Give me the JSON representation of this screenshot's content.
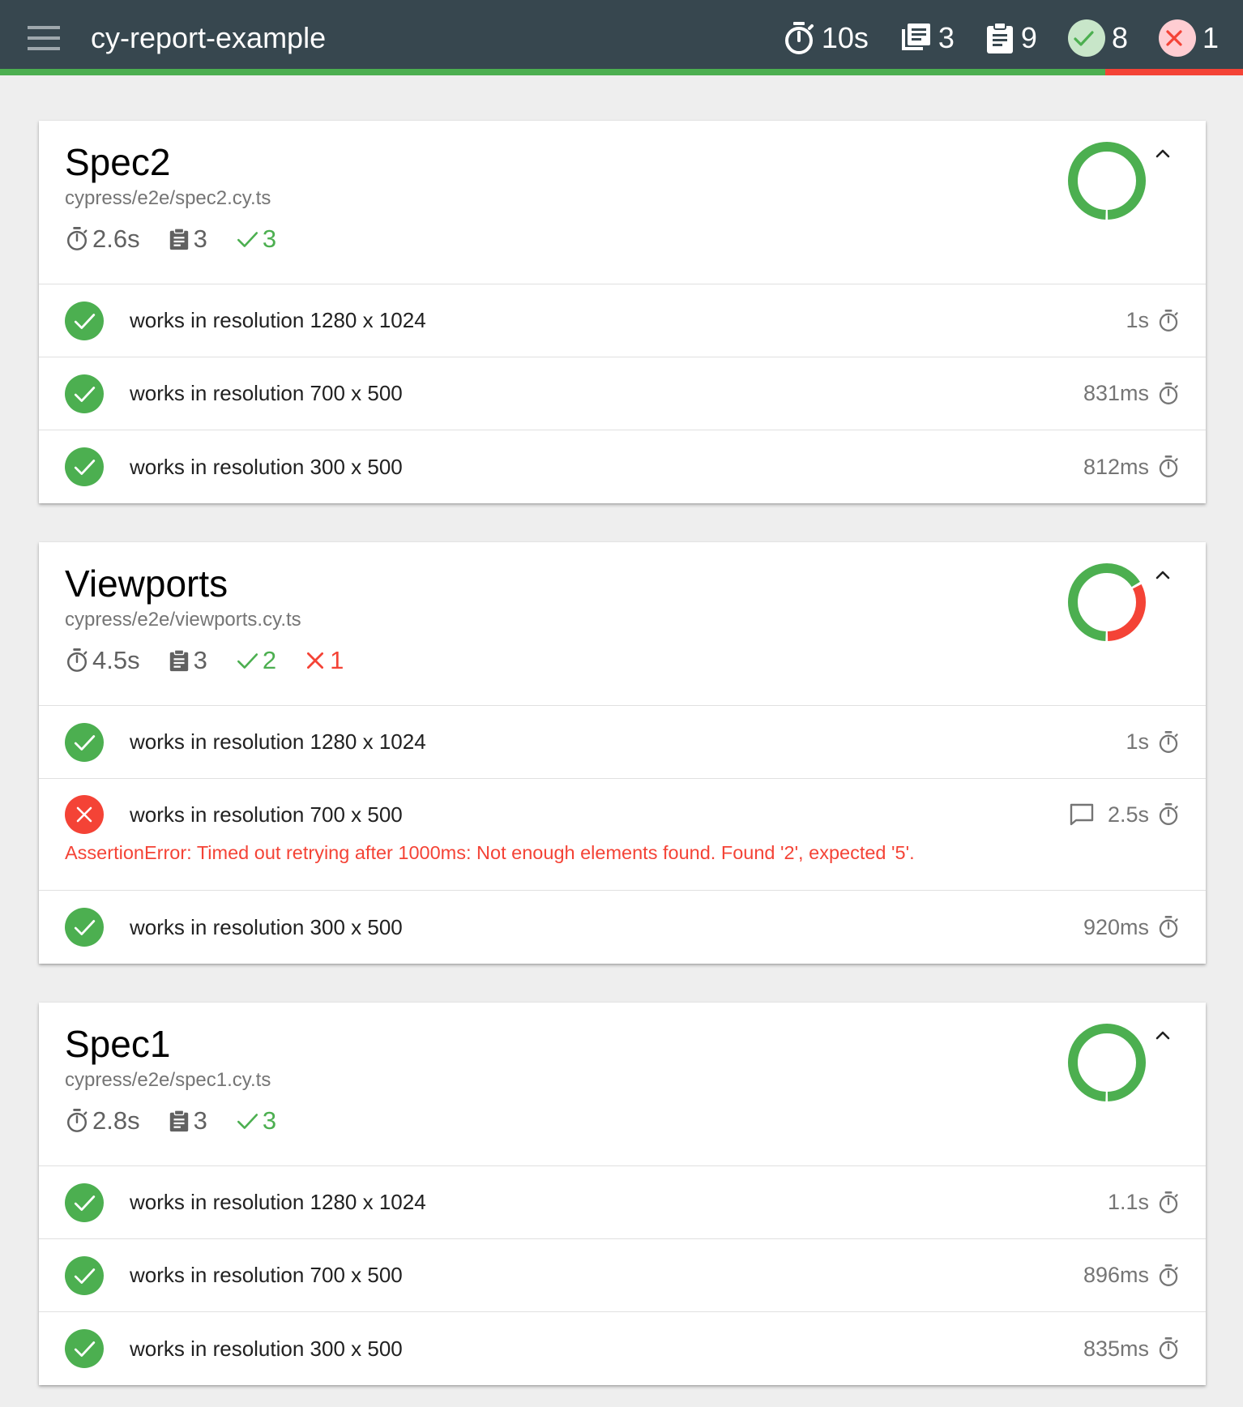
{
  "header": {
    "title": "cy-report-example",
    "stats": {
      "duration": "10s",
      "suites": "3",
      "tests": "9",
      "passed": "8",
      "failed": "1"
    },
    "pass_fraction": 0.889
  },
  "colors": {
    "topbar": "#37474f",
    "pass": "#4caf50",
    "fail": "#f44336",
    "pass_badge_bg": "#c8e6c9",
    "fail_badge_bg": "#ffcdd2"
  },
  "specs": [
    {
      "title": "Spec2",
      "path": "cypress/e2e/spec2.cy.ts",
      "duration": "2.6s",
      "tests": "3",
      "passed": "3",
      "failed": "",
      "pass_ratio": 1,
      "rows": [
        {
          "status": "pass",
          "title": "works in resolution 1280 x 1024",
          "duration": "1s"
        },
        {
          "status": "pass",
          "title": "works in resolution 700 x 500",
          "duration": "831ms"
        },
        {
          "status": "pass",
          "title": "works in resolution 300 x 500",
          "duration": "812ms"
        }
      ]
    },
    {
      "title": "Viewports",
      "path": "cypress/e2e/viewports.cy.ts",
      "duration": "4.5s",
      "tests": "3",
      "passed": "2",
      "failed": "1",
      "pass_ratio": 0.6667,
      "rows": [
        {
          "status": "pass",
          "title": "works in resolution 1280 x 1024",
          "duration": "1s"
        },
        {
          "status": "fail",
          "title": "works in resolution 700 x 500",
          "duration": "2.5s",
          "error": "AssertionError: Timed out retrying after 1000ms: Not enough elements found. Found '2', expected '5'."
        },
        {
          "status": "pass",
          "title": "works in resolution 300 x 500",
          "duration": "920ms"
        }
      ]
    },
    {
      "title": "Spec1",
      "path": "cypress/e2e/spec1.cy.ts",
      "duration": "2.8s",
      "tests": "3",
      "passed": "3",
      "failed": "",
      "pass_ratio": 1,
      "rows": [
        {
          "status": "pass",
          "title": "works in resolution 1280 x 1024",
          "duration": "1.1s"
        },
        {
          "status": "pass",
          "title": "works in resolution 700 x 500",
          "duration": "896ms"
        },
        {
          "status": "pass",
          "title": "works in resolution 300 x 500",
          "duration": "835ms"
        }
      ]
    }
  ]
}
